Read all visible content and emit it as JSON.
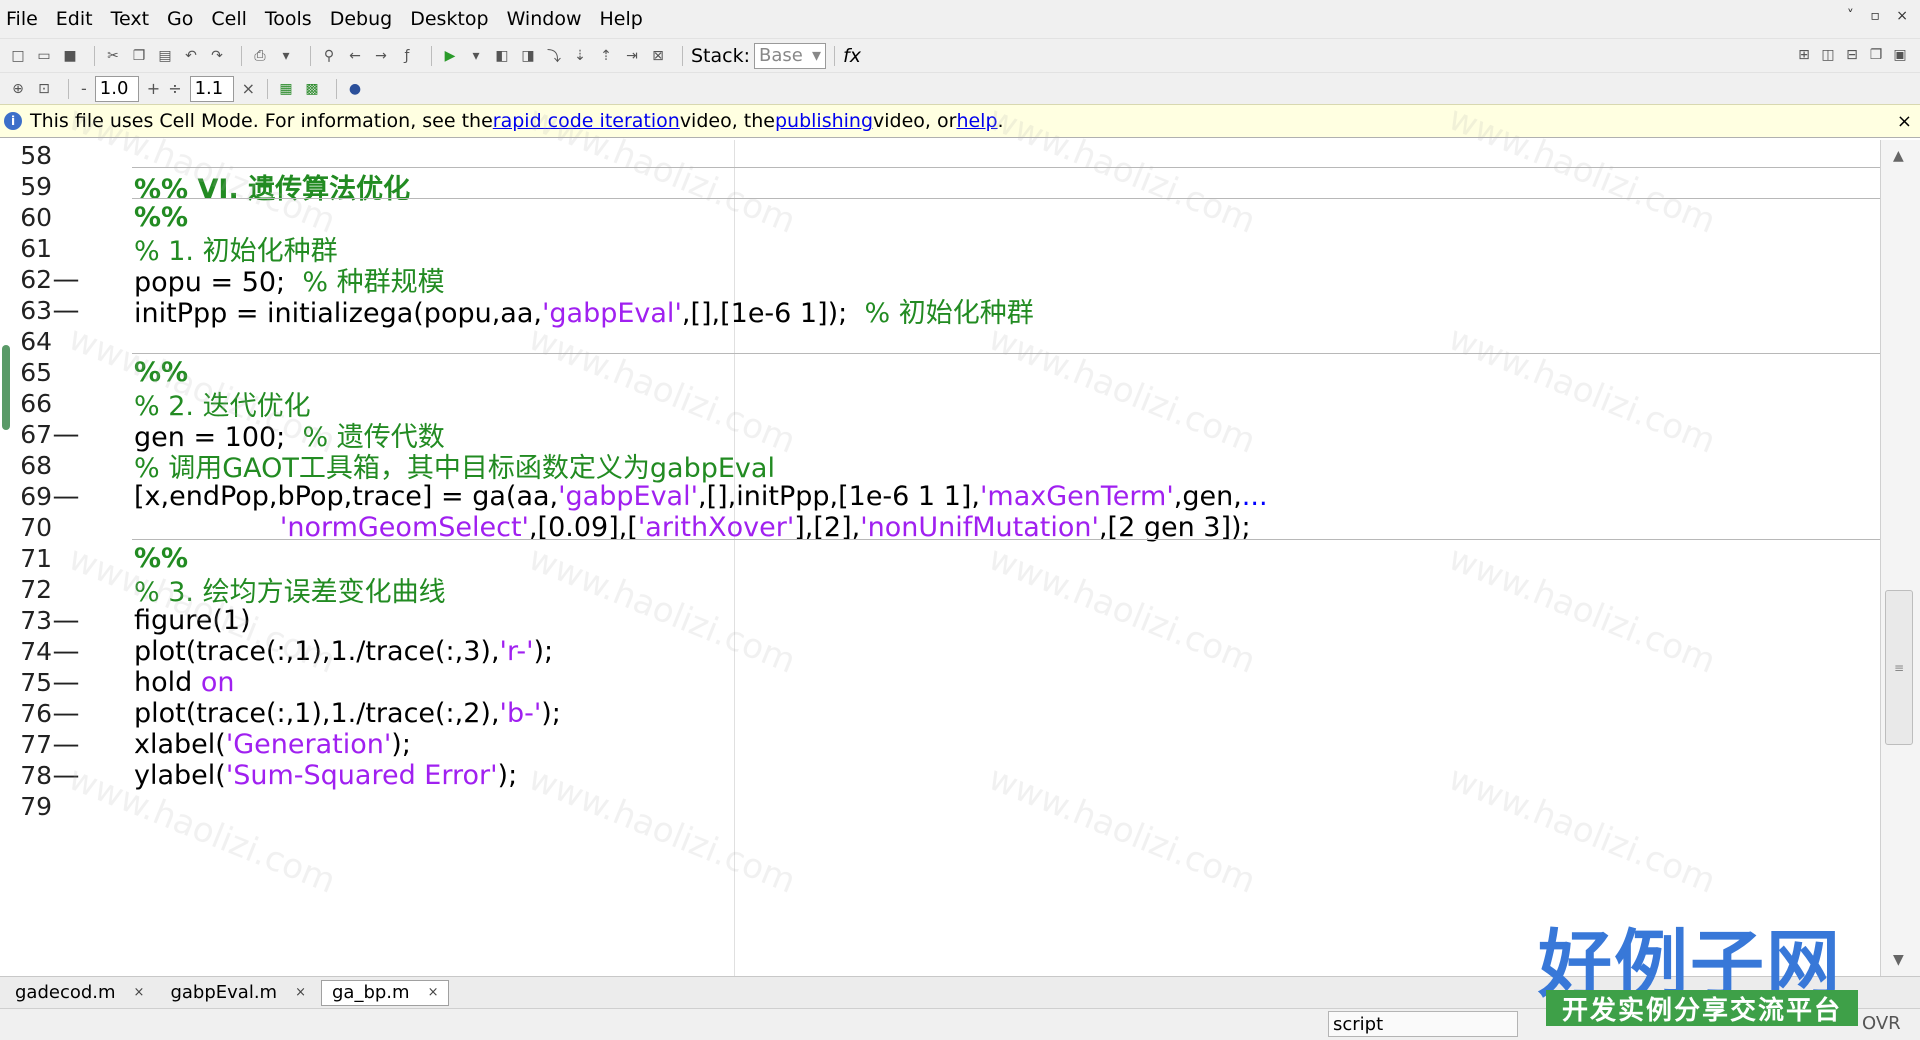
{
  "menu": [
    "File",
    "Edit",
    "Text",
    "Go",
    "Cell",
    "Tools",
    "Debug",
    "Desktop",
    "Window",
    "Help"
  ],
  "toolbar": {
    "stack_label": "Stack:",
    "stack_value": "Base",
    "fx_label": "fx",
    "cell_minus": "-",
    "cell_value1": "1.0",
    "cell_plus": "+",
    "cell_div": "÷",
    "cell_value2": "1.1",
    "cell_times": "×"
  },
  "infobar": {
    "prefix": "This file uses Cell Mode. For information, see the ",
    "link1": "rapid code iteration",
    "mid1": " video, the ",
    "link2": "publishing",
    "mid2": " video, or ",
    "link3": "help",
    "suffix": "."
  },
  "lines": [
    {
      "n": "58",
      "dash": false,
      "tokens": []
    },
    {
      "n": "59",
      "dash": false,
      "tokens": [
        {
          "t": "%% VI. 遗传算法优化",
          "c": "cell"
        }
      ]
    },
    {
      "n": "60",
      "dash": false,
      "tokens": [
        {
          "t": "%%",
          "c": "cell"
        }
      ]
    },
    {
      "n": "61",
      "dash": false,
      "tokens": [
        {
          "t": "% 1. 初始化种群",
          "c": "comment"
        }
      ]
    },
    {
      "n": "62",
      "dash": true,
      "tokens": [
        {
          "t": "popu = 50;  ",
          "c": "text"
        },
        {
          "t": "% 种群规模",
          "c": "comment"
        }
      ]
    },
    {
      "n": "63",
      "dash": true,
      "tokens": [
        {
          "t": "initPpp = initializega(popu,aa,",
          "c": "text"
        },
        {
          "t": "'gabpEval'",
          "c": "string"
        },
        {
          "t": ",[],[1e-6 1]);  ",
          "c": "text"
        },
        {
          "t": "% 初始化种群",
          "c": "comment"
        }
      ]
    },
    {
      "n": "64",
      "dash": false,
      "tokens": []
    },
    {
      "n": "65",
      "dash": false,
      "tokens": [
        {
          "t": "%%",
          "c": "cell"
        }
      ]
    },
    {
      "n": "66",
      "dash": false,
      "tokens": [
        {
          "t": "% 2. 迭代优化",
          "c": "comment"
        }
      ]
    },
    {
      "n": "67",
      "dash": true,
      "tokens": [
        {
          "t": "gen = 100;  ",
          "c": "text"
        },
        {
          "t": "% 遗传代数",
          "c": "comment"
        }
      ]
    },
    {
      "n": "68",
      "dash": false,
      "tokens": [
        {
          "t": "% 调用GAOT工具箱，其中目标函数定义为gabpEval",
          "c": "comment"
        }
      ]
    },
    {
      "n": "69",
      "dash": true,
      "tokens": [
        {
          "t": "[x,endPop,bPop,trace] = ga(aa,",
          "c": "text"
        },
        {
          "t": "'gabpEval'",
          "c": "string"
        },
        {
          "t": ",[],initPpp,[1e-6 1 1],",
          "c": "text"
        },
        {
          "t": "'maxGenTerm'",
          "c": "string"
        },
        {
          "t": ",gen,",
          "c": "text"
        },
        {
          "t": "...",
          "c": "ellipsis"
        }
      ]
    },
    {
      "n": "70",
      "dash": false,
      "tokens": [
        {
          "t": "                 ",
          "c": "text"
        },
        {
          "t": "'normGeomSelect'",
          "c": "string"
        },
        {
          "t": ",[0.09],[",
          "c": "text"
        },
        {
          "t": "'arithXover'",
          "c": "string"
        },
        {
          "t": "],[2],",
          "c": "text"
        },
        {
          "t": "'nonUnifMutation'",
          "c": "string"
        },
        {
          "t": ",[2 gen 3]);",
          "c": "text"
        }
      ]
    },
    {
      "n": "71",
      "dash": false,
      "tokens": [
        {
          "t": "%%",
          "c": "cell"
        }
      ]
    },
    {
      "n": "72",
      "dash": false,
      "tokens": [
        {
          "t": "% 3. 绘均方误差变化曲线",
          "c": "comment"
        }
      ]
    },
    {
      "n": "73",
      "dash": true,
      "tokens": [
        {
          "t": "figure(1)",
          "c": "text"
        }
      ]
    },
    {
      "n": "74",
      "dash": true,
      "tokens": [
        {
          "t": "plot(trace(:,1),1./trace(:,3),",
          "c": "text"
        },
        {
          "t": "'r-'",
          "c": "string"
        },
        {
          "t": ");",
          "c": "text"
        }
      ]
    },
    {
      "n": "75",
      "dash": true,
      "tokens": [
        {
          "t": "hold ",
          "c": "text"
        },
        {
          "t": "on",
          "c": "string"
        }
      ]
    },
    {
      "n": "76",
      "dash": true,
      "tokens": [
        {
          "t": "plot(trace(:,1),1./trace(:,2),",
          "c": "text"
        },
        {
          "t": "'b-'",
          "c": "string"
        },
        {
          "t": ");",
          "c": "text"
        }
      ]
    },
    {
      "n": "77",
      "dash": true,
      "tokens": [
        {
          "t": "xlabel(",
          "c": "text"
        },
        {
          "t": "'Generation'",
          "c": "string"
        },
        {
          "t": ");",
          "c": "text"
        }
      ]
    },
    {
      "n": "78",
      "dash": true,
      "tokens": [
        {
          "t": "ylabel(",
          "c": "text"
        },
        {
          "t": "'Sum-Squared Error'",
          "c": "string"
        },
        {
          "t": ");",
          "c": "text"
        }
      ]
    },
    {
      "n": "79",
      "dash": false,
      "tokens": []
    }
  ],
  "cell_dividers_after_line": [
    "58",
    "59",
    "64",
    "70"
  ],
  "tabs": [
    {
      "label": "gadecod.m",
      "active": false
    },
    {
      "label": "gabpEval.m",
      "active": false
    },
    {
      "label": "ga_bp.m",
      "active": true
    }
  ],
  "tab_close": "×",
  "status": {
    "mode": "script",
    "ovr": "OVR"
  },
  "watermark_text": "www.haolizi.com",
  "logo": {
    "main": "好例子网",
    "sub": "开发实例分享交流平台"
  },
  "colors": {
    "comment": "#228b22",
    "string": "#a020f0",
    "keyword": "#0000ff",
    "infobar_bg": "#ffffe1",
    "logo_blue": "#3878d8",
    "logo_green": "#3ea048"
  }
}
